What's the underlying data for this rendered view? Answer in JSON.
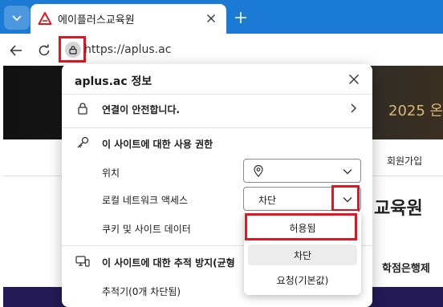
{
  "browser": {
    "tab_title": "에이플러스교육원",
    "url": "https://aplus.ac",
    "accent_color": "#1a7ad4",
    "highlight_color": "#e3161f"
  },
  "background_page": {
    "banner_text": "2025 온",
    "join_link": "회원가입",
    "logo_text": "교육원",
    "menu_text": "학점은행제"
  },
  "site_info": {
    "title": "aplus.ac 정보",
    "connection": "연결이 안전합니다.",
    "permissions_heading": "이 사이트에 대한 사용 권한",
    "location_label": "위치",
    "local_network_label": "로컬 네트워크 액세스",
    "local_network_value": "차단",
    "cookies_label": "쿠키 및 사이트 데이터",
    "tracking_heading": "이 사이트에 대한 추적 방지(균형",
    "trackers_text": "추적기(0개 차단됨)"
  },
  "dropdown": {
    "options": [
      "허용됨",
      "차단",
      "요청(기본값)"
    ]
  }
}
